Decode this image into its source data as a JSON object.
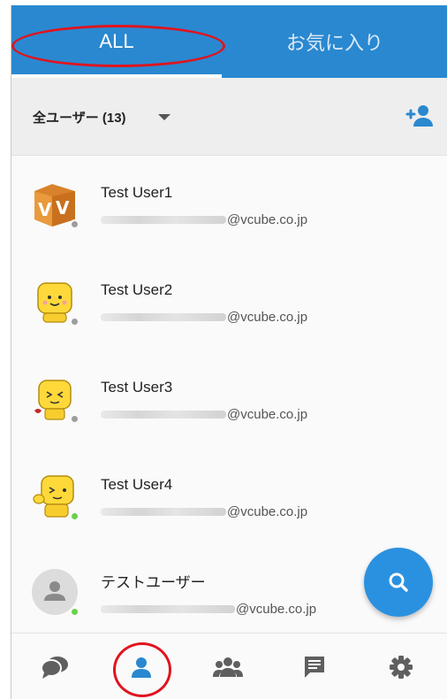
{
  "tabs": {
    "all_label": "ALL",
    "favorites_label": "お気に入り"
  },
  "filter": {
    "label": "全ユーザー (13)"
  },
  "users": [
    {
      "name": "Test User1",
      "email_domain": "@vcube.co.jp",
      "status": "offline",
      "avatar": "vcube-logo"
    },
    {
      "name": "Test User2",
      "email_domain": "@vcube.co.jp",
      "status": "offline",
      "avatar": "mascot-smile"
    },
    {
      "name": "Test User3",
      "email_domain": "@vcube.co.jp",
      "status": "offline",
      "avatar": "mascot-squint"
    },
    {
      "name": "Test User4",
      "email_domain": "@vcube.co.jp",
      "status": "online",
      "avatar": "mascot-wink"
    },
    {
      "name": "テストユーザー",
      "email_domain": "@vcube.co.jp",
      "status": "online",
      "avatar": "default-person"
    }
  ],
  "icons": {
    "add_user": "add-person-icon",
    "search": "search-icon",
    "nav": [
      "chat-icon",
      "contacts-icon",
      "groups-icon",
      "message-icon",
      "settings-icon"
    ]
  },
  "colors": {
    "primary": "#2a88d0",
    "fab": "#2a91e0",
    "nav_active": "#2a88d0",
    "nav_inactive": "#5f5f5f",
    "online": "#6ad14a",
    "offline": "#9e9e9e",
    "annotation": "#e0141e"
  }
}
